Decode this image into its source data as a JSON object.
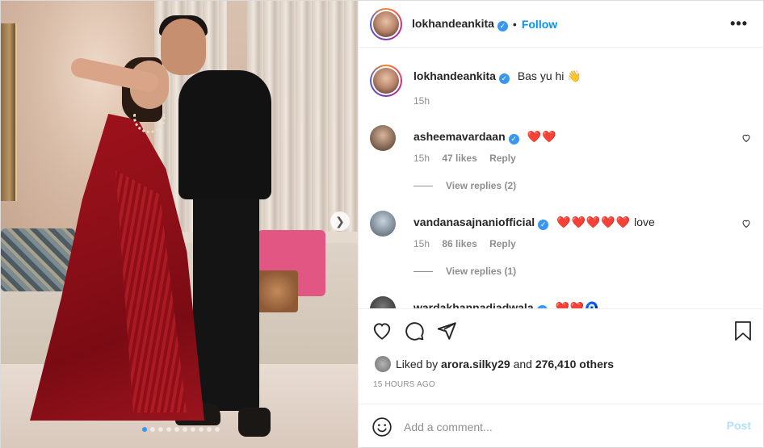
{
  "post": {
    "author": "lokhandeankita",
    "follow_label": "Follow",
    "more_label": "•••",
    "caption_text": "Bas yu hi 👋",
    "caption_time": "15h",
    "slides_count": 10,
    "active_slide": 0
  },
  "comments": [
    {
      "user": "asheemavardaan",
      "text": "❤️❤️",
      "time": "15h",
      "likes": "47 likes",
      "reply": "Reply",
      "view_replies": "View replies (2)"
    },
    {
      "user": "vandanasajnaniofficial",
      "text": "❤️❤️❤️❤️❤️",
      "text_suffix": "love",
      "time": "15h",
      "likes": "86 likes",
      "reply": "Reply",
      "view_replies": "View replies (1)"
    },
    {
      "user": "wardakhannadiadwala",
      "text": "❤️❤️🧿"
    }
  ],
  "actions": {
    "liked_prefix": "Liked by",
    "liked_user": "arora.silky29",
    "liked_and": "and",
    "liked_others": "276,410 others",
    "timestamp": "15 HOURS AGO"
  },
  "composer": {
    "placeholder": "Add a comment...",
    "post_label": "Post"
  },
  "colors": {
    "accent": "#0095f6",
    "verified": "#3897f0",
    "heart": "#ed4956",
    "post_disabled": "#b2dffc"
  },
  "icons": [
    "more-options-icon",
    "verified-badge-icon",
    "heart-icon",
    "comment-icon",
    "share-icon",
    "bookmark-icon",
    "emoji-icon",
    "carousel-next-icon"
  ]
}
